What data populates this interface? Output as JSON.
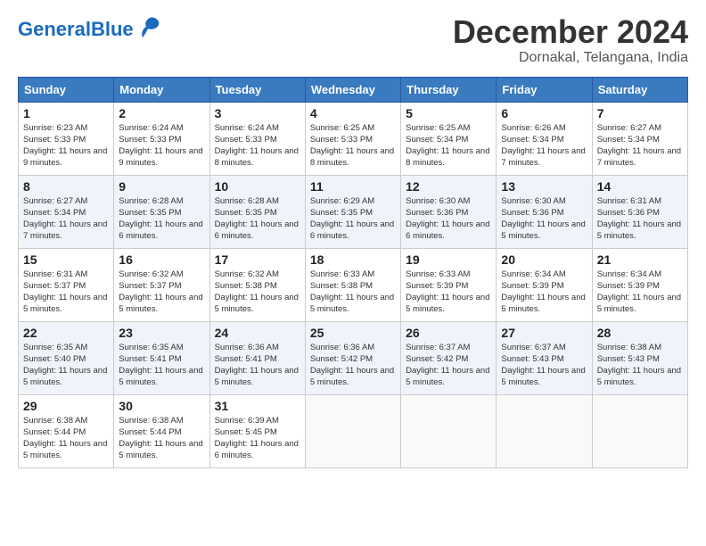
{
  "header": {
    "logo_general": "General",
    "logo_blue": "Blue",
    "month_title": "December 2024",
    "location": "Dornakal, Telangana, India"
  },
  "weekdays": [
    "Sunday",
    "Monday",
    "Tuesday",
    "Wednesday",
    "Thursday",
    "Friday",
    "Saturday"
  ],
  "weeks": [
    [
      {
        "day": "1",
        "sunrise": "6:23 AM",
        "sunset": "5:33 PM",
        "daylight": "11 hours and 9 minutes"
      },
      {
        "day": "2",
        "sunrise": "6:24 AM",
        "sunset": "5:33 PM",
        "daylight": "11 hours and 9 minutes"
      },
      {
        "day": "3",
        "sunrise": "6:24 AM",
        "sunset": "5:33 PM",
        "daylight": "11 hours and 8 minutes"
      },
      {
        "day": "4",
        "sunrise": "6:25 AM",
        "sunset": "5:33 PM",
        "daylight": "11 hours and 8 minutes"
      },
      {
        "day": "5",
        "sunrise": "6:25 AM",
        "sunset": "5:34 PM",
        "daylight": "11 hours and 8 minutes"
      },
      {
        "day": "6",
        "sunrise": "6:26 AM",
        "sunset": "5:34 PM",
        "daylight": "11 hours and 7 minutes"
      },
      {
        "day": "7",
        "sunrise": "6:27 AM",
        "sunset": "5:34 PM",
        "daylight": "11 hours and 7 minutes"
      }
    ],
    [
      {
        "day": "8",
        "sunrise": "6:27 AM",
        "sunset": "5:34 PM",
        "daylight": "11 hours and 7 minutes"
      },
      {
        "day": "9",
        "sunrise": "6:28 AM",
        "sunset": "5:35 PM",
        "daylight": "11 hours and 6 minutes"
      },
      {
        "day": "10",
        "sunrise": "6:28 AM",
        "sunset": "5:35 PM",
        "daylight": "11 hours and 6 minutes"
      },
      {
        "day": "11",
        "sunrise": "6:29 AM",
        "sunset": "5:35 PM",
        "daylight": "11 hours and 6 minutes"
      },
      {
        "day": "12",
        "sunrise": "6:30 AM",
        "sunset": "5:36 PM",
        "daylight": "11 hours and 6 minutes"
      },
      {
        "day": "13",
        "sunrise": "6:30 AM",
        "sunset": "5:36 PM",
        "daylight": "11 hours and 5 minutes"
      },
      {
        "day": "14",
        "sunrise": "6:31 AM",
        "sunset": "5:36 PM",
        "daylight": "11 hours and 5 minutes"
      }
    ],
    [
      {
        "day": "15",
        "sunrise": "6:31 AM",
        "sunset": "5:37 PM",
        "daylight": "11 hours and 5 minutes"
      },
      {
        "day": "16",
        "sunrise": "6:32 AM",
        "sunset": "5:37 PM",
        "daylight": "11 hours and 5 minutes"
      },
      {
        "day": "17",
        "sunrise": "6:32 AM",
        "sunset": "5:38 PM",
        "daylight": "11 hours and 5 minutes"
      },
      {
        "day": "18",
        "sunrise": "6:33 AM",
        "sunset": "5:38 PM",
        "daylight": "11 hours and 5 minutes"
      },
      {
        "day": "19",
        "sunrise": "6:33 AM",
        "sunset": "5:39 PM",
        "daylight": "11 hours and 5 minutes"
      },
      {
        "day": "20",
        "sunrise": "6:34 AM",
        "sunset": "5:39 PM",
        "daylight": "11 hours and 5 minutes"
      },
      {
        "day": "21",
        "sunrise": "6:34 AM",
        "sunset": "5:39 PM",
        "daylight": "11 hours and 5 minutes"
      }
    ],
    [
      {
        "day": "22",
        "sunrise": "6:35 AM",
        "sunset": "5:40 PM",
        "daylight": "11 hours and 5 minutes"
      },
      {
        "day": "23",
        "sunrise": "6:35 AM",
        "sunset": "5:41 PM",
        "daylight": "11 hours and 5 minutes"
      },
      {
        "day": "24",
        "sunrise": "6:36 AM",
        "sunset": "5:41 PM",
        "daylight": "11 hours and 5 minutes"
      },
      {
        "day": "25",
        "sunrise": "6:36 AM",
        "sunset": "5:42 PM",
        "daylight": "11 hours and 5 minutes"
      },
      {
        "day": "26",
        "sunrise": "6:37 AM",
        "sunset": "5:42 PM",
        "daylight": "11 hours and 5 minutes"
      },
      {
        "day": "27",
        "sunrise": "6:37 AM",
        "sunset": "5:43 PM",
        "daylight": "11 hours and 5 minutes"
      },
      {
        "day": "28",
        "sunrise": "6:38 AM",
        "sunset": "5:43 PM",
        "daylight": "11 hours and 5 minutes"
      }
    ],
    [
      {
        "day": "29",
        "sunrise": "6:38 AM",
        "sunset": "5:44 PM",
        "daylight": "11 hours and 5 minutes"
      },
      {
        "day": "30",
        "sunrise": "6:38 AM",
        "sunset": "5:44 PM",
        "daylight": "11 hours and 5 minutes"
      },
      {
        "day": "31",
        "sunrise": "6:39 AM",
        "sunset": "5:45 PM",
        "daylight": "11 hours and 6 minutes"
      },
      null,
      null,
      null,
      null
    ]
  ]
}
